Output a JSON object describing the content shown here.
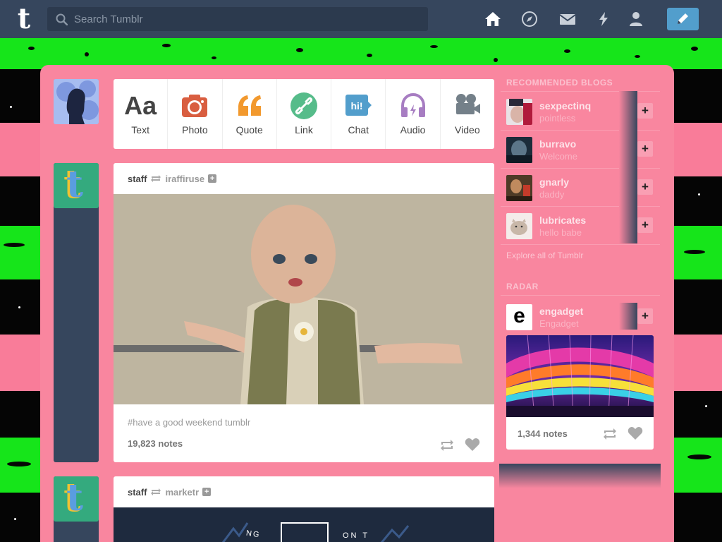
{
  "topbar": {
    "logo": "t",
    "search_placeholder": "Search Tumblr",
    "nav": [
      "home-icon",
      "explore-compass-icon",
      "inbox-mail-icon",
      "activity-lightning-icon",
      "account-person-icon"
    ],
    "compose_icon": "pencil-icon"
  },
  "composer": {
    "items": [
      {
        "label": "Text",
        "icon": "text-aa-icon",
        "color": "#444444"
      },
      {
        "label": "Photo",
        "icon": "camera-icon",
        "color": "#d95e40"
      },
      {
        "label": "Quote",
        "icon": "quote-icon",
        "color": "#f2992e"
      },
      {
        "label": "Link",
        "icon": "link-icon",
        "color": "#56bc8a"
      },
      {
        "label": "Chat",
        "icon": "chat-bubble-icon",
        "color": "#529ecc"
      },
      {
        "label": "Audio",
        "icon": "headphones-icon",
        "color": "#a77dc2"
      },
      {
        "label": "Video",
        "icon": "video-camera-icon",
        "color": "#748089"
      }
    ],
    "aa": "Aa",
    "chat_glyph": "hi!"
  },
  "posts": [
    {
      "author": "staff",
      "reblogged_from": "iraffiruse",
      "tags": "#have a good weekend tumblr",
      "notes": "19,823 notes"
    },
    {
      "author": "staff",
      "reblogged_from": "marketr",
      "banner_text_left": "NG",
      "banner_text_right": "ON T"
    }
  ],
  "sidebar": {
    "recommended_title": "RECOMMENDED BLOGS",
    "recommended": [
      {
        "name": "sexpectinq",
        "title": "pointless"
      },
      {
        "name": "burravo",
        "title": "Welcome"
      },
      {
        "name": "gnarly",
        "title": "daddy"
      },
      {
        "name": "lubricates",
        "title": "hello babe"
      }
    ],
    "follow_glyph": "+",
    "explore_link": "Explore all of Tumblr",
    "radar_title": "RADAR",
    "radar": {
      "name": "engadget",
      "title": "Engadget",
      "logo_glyph": "e",
      "notes": "1,344 notes"
    }
  },
  "colors": {
    "navy": "#36465d",
    "pink": "#f9869f",
    "green": "#16e51a",
    "compose_blue": "#529ecc"
  }
}
